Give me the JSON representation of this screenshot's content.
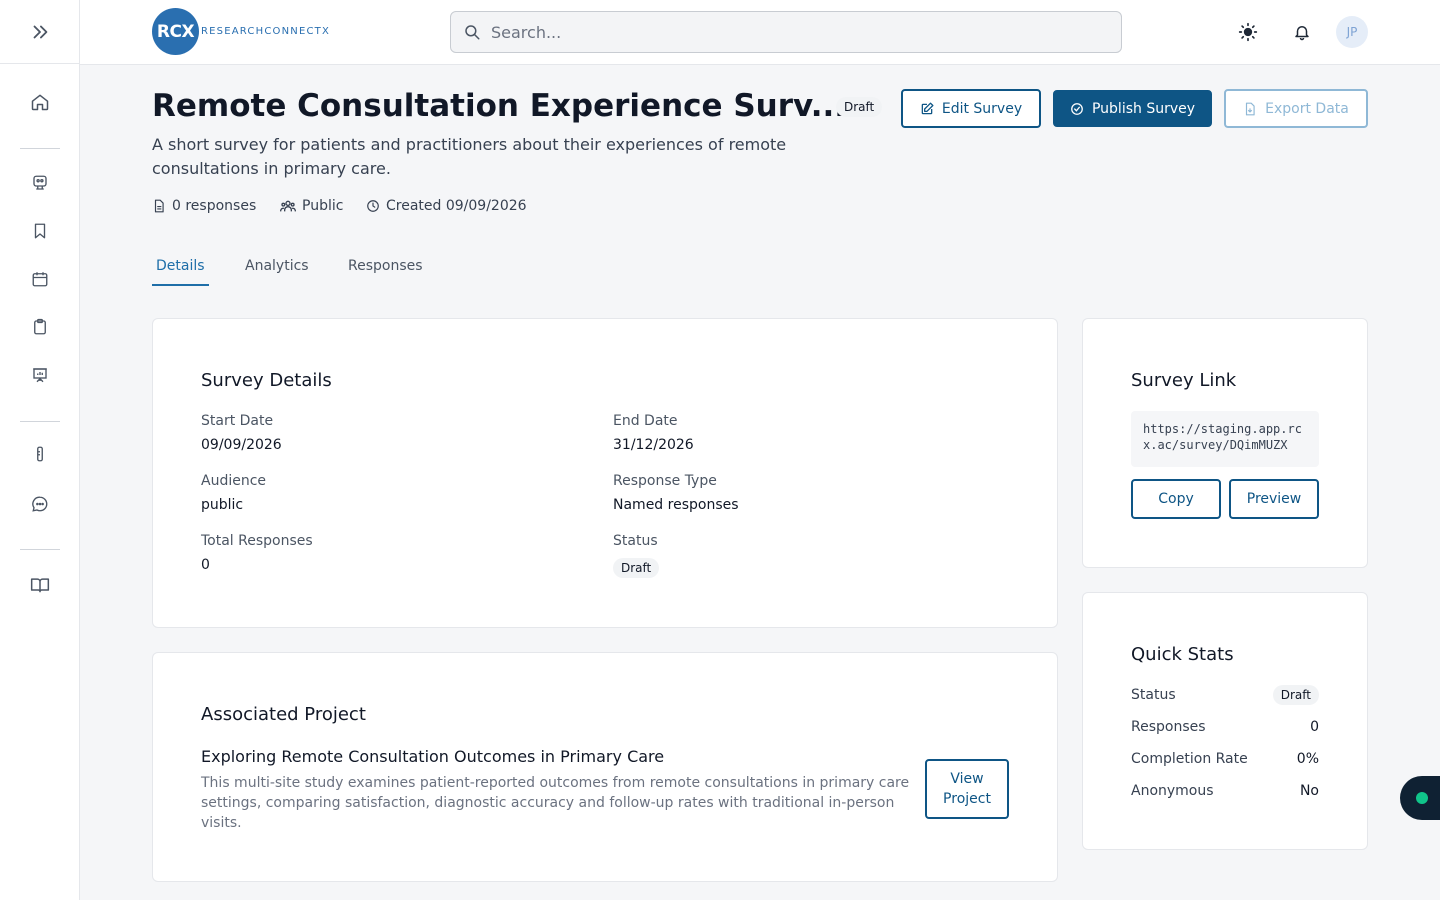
{
  "brand": {
    "short": "RCX",
    "name": "RESEARCHCONNECTX"
  },
  "search": {
    "placeholder": "Search..."
  },
  "user": {
    "initials": "JP"
  },
  "survey": {
    "title": "Remote Consultation Experience Surv...",
    "status_badge": "Draft",
    "description": "A short survey for patients and practitioners about their experiences of remote consultations in primary care.",
    "meta": {
      "responses": "0 responses",
      "visibility": "Public",
      "created": "Created 09/09/2026"
    }
  },
  "actions": {
    "edit": "Edit Survey",
    "publish": "Publish Survey",
    "export": "Export Data"
  },
  "tabs": [
    "Details",
    "Analytics",
    "Responses"
  ],
  "details": {
    "title": "Survey Details",
    "start_label": "Start Date",
    "start_value": "09/09/2026",
    "end_label": "End Date",
    "end_value": "31/12/2026",
    "audience_label": "Audience",
    "audience_value": "public",
    "response_type_label": "Response Type",
    "response_type_value": "Named responses",
    "total_label": "Total Responses",
    "total_value": "0",
    "status_label": "Status",
    "status_value": "Draft"
  },
  "project": {
    "section_title": "Associated Project",
    "name": "Exploring Remote Consultation Outcomes in Primary Care",
    "description": "This multi-site study examines patient-reported outcomes from remote consultations in primary care settings, comparing satisfaction, diagnostic accuracy and follow-up rates with traditional in-person visits.",
    "view_line1": "View",
    "view_line2": "Project"
  },
  "link": {
    "title": "Survey Link",
    "url": "https://staging.app.rcx.ac/survey/DQimMUZX",
    "copy": "Copy",
    "preview": "Preview"
  },
  "quick_stats": {
    "title": "Quick Stats",
    "rows": [
      {
        "label": "Status",
        "value": "Draft"
      },
      {
        "label": "Responses",
        "value": "0"
      },
      {
        "label": "Completion Rate",
        "value": "0%"
      },
      {
        "label": "Anonymous",
        "value": "No"
      }
    ]
  },
  "colors": {
    "primary": "#0e5585",
    "brand": "#2a6fb0",
    "accent_tab": "#1e6ea8",
    "online_dot": "#10c48a"
  }
}
